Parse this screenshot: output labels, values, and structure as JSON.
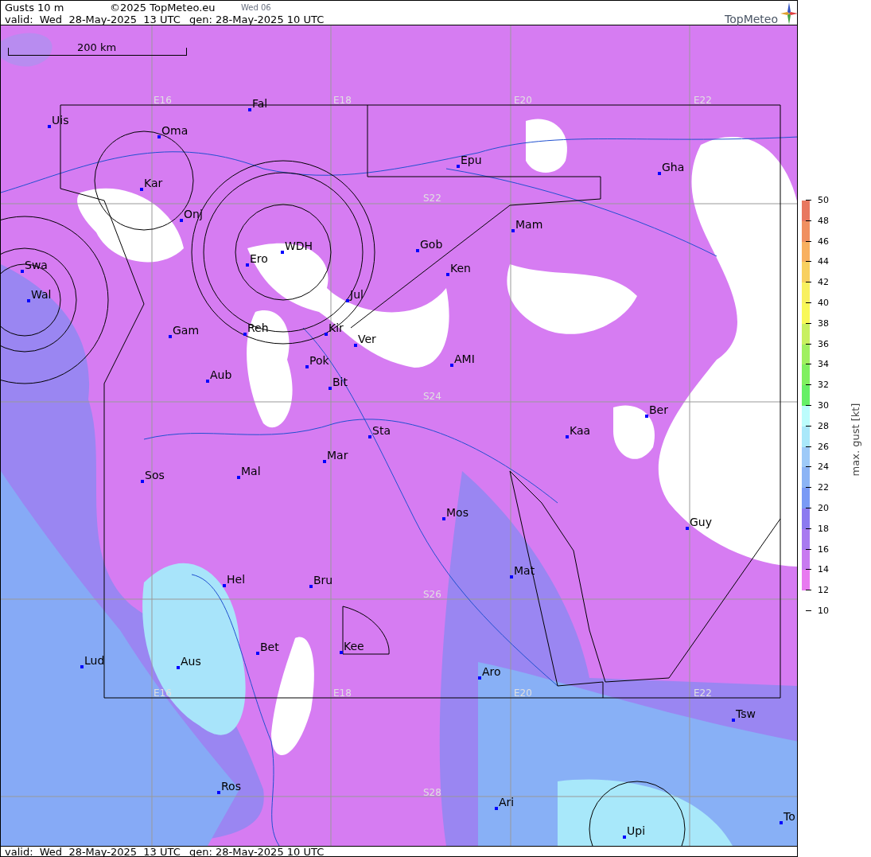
{
  "header": {
    "title": "Gusts 10 m",
    "copyright": "©2025 TopMeteo.eu",
    "day_code": "Wed 06",
    "valid": "valid:  Wed  28-May-2025  13 UTC",
    "generated": "gen: 28-May-2025 10 UTC",
    "logo": "TopMeteo"
  },
  "map": {
    "scale_label": "200 km",
    "grid_labels": [
      "E16",
      "E18",
      "E20",
      "E22",
      "S22",
      "S24",
      "S26",
      "S28",
      "E16",
      "E18",
      "E20",
      "E22"
    ],
    "places": [
      "Uis",
      "Oma",
      "Fal",
      "Epu",
      "Gha",
      "Kar",
      "Onj",
      "Mam",
      "Gob",
      "WDH",
      "Ero",
      "Swa",
      "Ken",
      "Wal",
      "Jul",
      "Gam",
      "Reh",
      "Kir",
      "Ver",
      "AMI",
      "Pok",
      "Aub",
      "Bit",
      "Ber",
      "Sta",
      "Kaa",
      "Mar",
      "Sos",
      "Mal",
      "Mos",
      "Guy",
      "Mat",
      "Hel",
      "Bru",
      "Bet",
      "Kee",
      "Lud",
      "Aus",
      "Aro",
      "Tsw",
      "Ros",
      "Ari",
      "To",
      "Upi"
    ]
  },
  "legend": {
    "title": "max. gust [kt]",
    "bands": [
      {
        "color": "#e87af0"
      },
      {
        "color": "#c87af0"
      },
      {
        "color": "#a87af0"
      },
      {
        "color": "#8c7af0"
      },
      {
        "color": "#7a9af5"
      },
      {
        "color": "#8cb4f5"
      },
      {
        "color": "#9ecaf8"
      },
      {
        "color": "#aae8fa"
      },
      {
        "color": "#bcfcfc"
      },
      {
        "color": "#66f066"
      },
      {
        "color": "#80f060"
      },
      {
        "color": "#a0f060"
      },
      {
        "color": "#c8f060"
      },
      {
        "color": "#f8f858"
      },
      {
        "color": "#f8f060"
      },
      {
        "color": "#f8d060"
      },
      {
        "color": "#f8b060"
      },
      {
        "color": "#f09060"
      },
      {
        "color": "#e87860"
      }
    ],
    "ticks": [
      "50",
      "48",
      "46",
      "44",
      "42",
      "40",
      "38",
      "36",
      "34",
      "32",
      "30",
      "28",
      "26",
      "24",
      "22",
      "20",
      "18",
      "16",
      "14",
      "12",
      "10"
    ]
  },
  "footer": {
    "valid": "valid:  Wed  28-May-2025  13 UTC",
    "generated": "gen: 28-May-2025 10 UTC"
  }
}
